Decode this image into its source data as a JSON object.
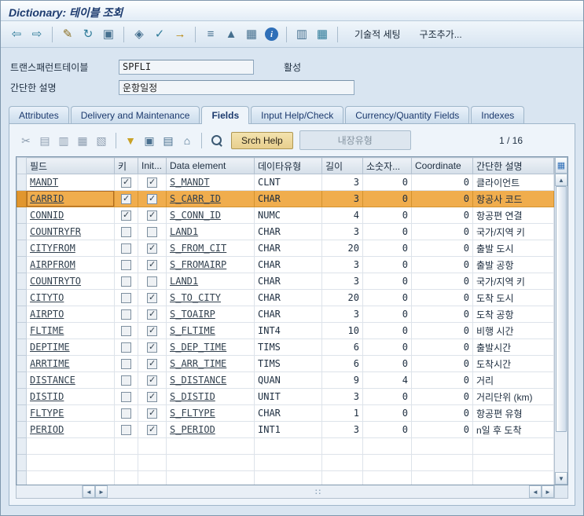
{
  "colors": {
    "selected_row": "#f0ad4d",
    "title_text": "#1c3a6e",
    "srch_help_bg": "#e8cf8e"
  },
  "titlebar": {
    "title": "Dictionary: 테이블 조회"
  },
  "toolbar": {
    "icon_groups": [
      [
        {
          "name": "back-icon",
          "glyph": "⇦",
          "color": "#2e7b99"
        },
        {
          "name": "forward-icon",
          "glyph": "⇨",
          "color": "#2e7b99"
        }
      ],
      [
        {
          "name": "display-change-icon",
          "glyph": "✎",
          "color": "#8a6d1f"
        },
        {
          "name": "refresh-icon",
          "glyph": "↻",
          "color": "#2e7b99"
        },
        {
          "name": "copy-icon",
          "glyph": "▣",
          "color": "#46708f"
        }
      ],
      [
        {
          "name": "where-used-icon",
          "glyph": "◈",
          "color": "#46708f"
        },
        {
          "name": "check-icon",
          "glyph": "✓",
          "color": "#2e7b99"
        },
        {
          "name": "goto-icon",
          "glyph": "→",
          "color": "#b8860b"
        }
      ],
      [
        {
          "name": "hierarchy-icon",
          "glyph": "≡",
          "color": "#46708f"
        },
        {
          "name": "sort-icon",
          "glyph": "▲",
          "color": "#46708f"
        },
        {
          "name": "table-display-icon",
          "glyph": "▦",
          "color": "#46708f"
        },
        {
          "name": "info-icon",
          "glyph": "i",
          "color": "#ffffff"
        }
      ],
      [
        {
          "name": "runtime-object-icon",
          "glyph": "▥",
          "color": "#46708f"
        },
        {
          "name": "table-contents-icon",
          "glyph": "▦",
          "color": "#2e7b99"
        }
      ]
    ],
    "text_buttons": [
      {
        "name": "technical-settings-button",
        "label": "기술적 세팅"
      },
      {
        "name": "append-structure-button",
        "label": "구조추가..."
      }
    ]
  },
  "form": {
    "table_label": "트랜스패런트테이블",
    "table_name": "SPFLI",
    "status": "활성",
    "description_label": "간단한 설명",
    "description": "운항일정"
  },
  "tabs": {
    "labels": [
      "Attributes",
      "Delivery and Maintenance",
      "Fields",
      "Input Help/Check",
      "Currency/Quantity Fields",
      "Indexes"
    ],
    "active_index": 2
  },
  "grid": {
    "toolbar": {
      "icon_groups": [
        [
          {
            "name": "cut-icon",
            "glyph": "✂",
            "color": "#8d9daf"
          },
          {
            "name": "copy-rows-icon",
            "glyph": "▤",
            "color": "#8d9daf"
          },
          {
            "name": "paste-rows-icon",
            "glyph": "▥",
            "color": "#8d9daf"
          },
          {
            "name": "insert-row-icon",
            "glyph": "▦",
            "color": "#8d9daf"
          },
          {
            "name": "delete-row-icon",
            "glyph": "▧",
            "color": "#8d9daf"
          }
        ],
        [
          {
            "name": "filter-icon",
            "glyph": "▼",
            "color": "#c9a227"
          },
          {
            "name": "select-block-icon",
            "glyph": "▣",
            "color": "#4a708f"
          },
          {
            "name": "period-icon",
            "glyph": "▤",
            "color": "#4a708f"
          },
          {
            "name": "home-icon",
            "glyph": "⌂",
            "color": "#4a708f"
          }
        ],
        [
          {
            "name": "search-icon",
            "glyph": "",
            "color": "#3c5a74"
          }
        ]
      ],
      "srch_help_label": "Srch Help",
      "builtin_type_label": "내장유형",
      "position": "1 / 16"
    },
    "columns": [
      {
        "key": "field",
        "label": "필드"
      },
      {
        "key": "key",
        "label": "키"
      },
      {
        "key": "init",
        "label": "Init..."
      },
      {
        "key": "data_element",
        "label": "Data element"
      },
      {
        "key": "type",
        "label": "데이타유형"
      },
      {
        "key": "length",
        "label": "길이"
      },
      {
        "key": "decimals",
        "label": "소숫자..."
      },
      {
        "key": "coordinate",
        "label": "Coordinate"
      },
      {
        "key": "description",
        "label": "간단한 설명"
      }
    ],
    "rows": [
      {
        "field": "MANDT",
        "key": true,
        "init": true,
        "data_element": "S_MANDT",
        "type": "CLNT",
        "length": "3",
        "decimals": "0",
        "coordinate": "0",
        "description": "클라이언트",
        "selected": false
      },
      {
        "field": "CARRID",
        "key": true,
        "init": true,
        "data_element": "S_CARR_ID",
        "type": "CHAR",
        "length": "3",
        "decimals": "0",
        "coordinate": "0",
        "description": "항공사 코드",
        "selected": true
      },
      {
        "field": "CONNID",
        "key": true,
        "init": true,
        "data_element": "S_CONN_ID",
        "type": "NUMC",
        "length": "4",
        "decimals": "0",
        "coordinate": "0",
        "description": "항공편 연결",
        "selected": false
      },
      {
        "field": "COUNTRYFR",
        "key": false,
        "init": false,
        "data_element": "LAND1",
        "type": "CHAR",
        "length": "3",
        "decimals": "0",
        "coordinate": "0",
        "description": "국가/지역 키",
        "selected": false
      },
      {
        "field": "CITYFROM",
        "key": false,
        "init": true,
        "data_element": "S_FROM_CIT",
        "type": "CHAR",
        "length": "20",
        "decimals": "0",
        "coordinate": "0",
        "description": "출발 도시",
        "selected": false
      },
      {
        "field": "AIRPFROM",
        "key": false,
        "init": true,
        "data_element": "S_FROMAIRP",
        "type": "CHAR",
        "length": "3",
        "decimals": "0",
        "coordinate": "0",
        "description": "출발 공항",
        "selected": false
      },
      {
        "field": "COUNTRYTO",
        "key": false,
        "init": false,
        "data_element": "LAND1",
        "type": "CHAR",
        "length": "3",
        "decimals": "0",
        "coordinate": "0",
        "description": "국가/지역 키",
        "selected": false
      },
      {
        "field": "CITYTO",
        "key": false,
        "init": true,
        "data_element": "S_TO_CITY",
        "type": "CHAR",
        "length": "20",
        "decimals": "0",
        "coordinate": "0",
        "description": "도착 도시",
        "selected": false
      },
      {
        "field": "AIRPTO",
        "key": false,
        "init": true,
        "data_element": "S_TOAIRP",
        "type": "CHAR",
        "length": "3",
        "decimals": "0",
        "coordinate": "0",
        "description": "도착 공항",
        "selected": false
      },
      {
        "field": "FLTIME",
        "key": false,
        "init": true,
        "data_element": "S_FLTIME",
        "type": "INT4",
        "length": "10",
        "decimals": "0",
        "coordinate": "0",
        "description": "비행 시간",
        "selected": false
      },
      {
        "field": "DEPTIME",
        "key": false,
        "init": true,
        "data_element": "S_DEP_TIME",
        "type": "TIMS",
        "length": "6",
        "decimals": "0",
        "coordinate": "0",
        "description": "출발시간",
        "selected": false
      },
      {
        "field": "ARRTIME",
        "key": false,
        "init": true,
        "data_element": "S_ARR_TIME",
        "type": "TIMS",
        "length": "6",
        "decimals": "0",
        "coordinate": "0",
        "description": "도착시간",
        "selected": false
      },
      {
        "field": "DISTANCE",
        "key": false,
        "init": true,
        "data_element": "S_DISTANCE",
        "type": "QUAN",
        "length": "9",
        "decimals": "4",
        "coordinate": "0",
        "description": "거리",
        "selected": false
      },
      {
        "field": "DISTID",
        "key": false,
        "init": true,
        "data_element": "S_DISTID",
        "type": "UNIT",
        "length": "3",
        "decimals": "0",
        "coordinate": "0",
        "description": "거리단위 (km)",
        "selected": false
      },
      {
        "field": "FLTYPE",
        "key": false,
        "init": true,
        "data_element": "S_FLTYPE",
        "type": "CHAR",
        "length": "1",
        "decimals": "0",
        "coordinate": "0",
        "description": "항공편 유형",
        "selected": false
      },
      {
        "field": "PERIOD",
        "key": false,
        "init": true,
        "data_element": "S_PERIOD",
        "type": "INT1",
        "length": "3",
        "decimals": "0",
        "coordinate": "0",
        "description": "n일 후 도착",
        "selected": false
      }
    ],
    "empty_rows": 3
  },
  "scrollbar": {
    "settings": "▦",
    "up": "▲",
    "down": "▼",
    "left": "◄",
    "right": "►",
    "grip": "∷"
  }
}
